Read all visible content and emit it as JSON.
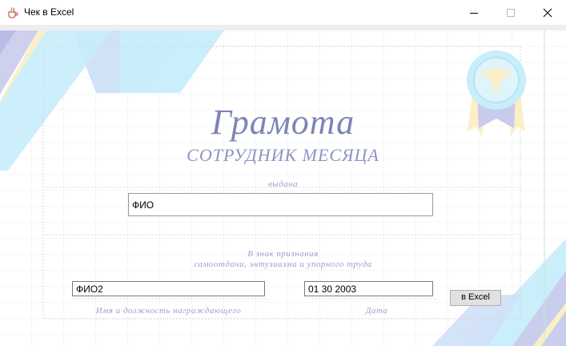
{
  "window": {
    "title": "Чек в Excel",
    "app_icon": "java-cup-icon",
    "controls": [
      "minimize-icon",
      "maximize-icon",
      "close-icon"
    ]
  },
  "certificate": {
    "title": "Грамота",
    "subtitle": "СОТРУДНИК МЕСЯЦА",
    "issued_to_label": "выдана",
    "recognition_line1": "В знак признания",
    "recognition_line2": "самоотдачи, энтузиазма и упорного труда",
    "awarder_caption": "Имя и должность награждающего",
    "date_caption": "Дата"
  },
  "form": {
    "recipient_value": "ФИО",
    "awarder_value": "ФИО2",
    "date_value": "01 30 2003",
    "export_button_label": "в Excel"
  },
  "colors": {
    "accent_text": "#7d84b6",
    "stripe_blue": "#c8edfb",
    "stripe_lilac": "#c9cbec",
    "stripe_cream": "#fcefc8"
  }
}
